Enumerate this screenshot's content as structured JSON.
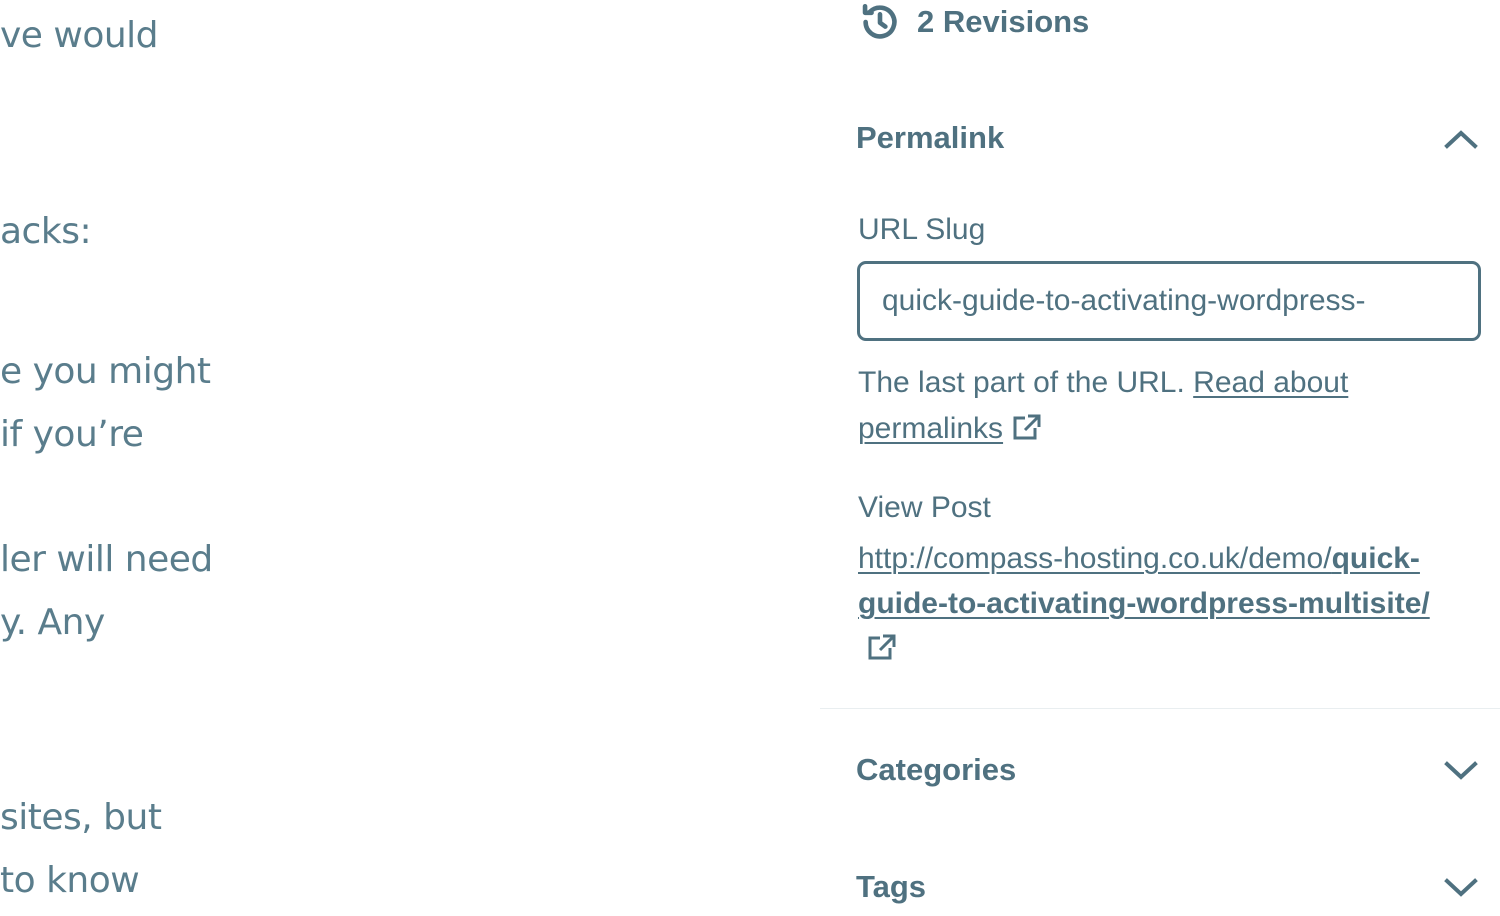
{
  "editor": {
    "fragments": [
      "ve would",
      "acks:",
      "e you might",
      "if you’re",
      "ler will need",
      "y. Any",
      "sites, but",
      " to know"
    ]
  },
  "sidebar": {
    "revisions": {
      "icon": "history-icon",
      "label": "2 Revisions"
    },
    "permalink": {
      "title": "Permalink",
      "expanded": true,
      "url_slug_label": "URL Slug",
      "url_slug_value": "quick-guide-to-activating-wordpress-",
      "help_text": "The last part of the URL.",
      "help_link_text": "Read about permalinks",
      "view_post_label": "View Post",
      "view_post_url_base": "http://compass-hosting.co.uk/demo/",
      "view_post_url_slug": "quick-guide-to-activating-wordpress-multisite/"
    },
    "categories": {
      "title": "Categories",
      "expanded": false
    },
    "tags": {
      "title": "Tags",
      "expanded": false
    }
  },
  "colors": {
    "text": "#4f7180",
    "border": "#4f7180",
    "background": "#ffffff"
  }
}
